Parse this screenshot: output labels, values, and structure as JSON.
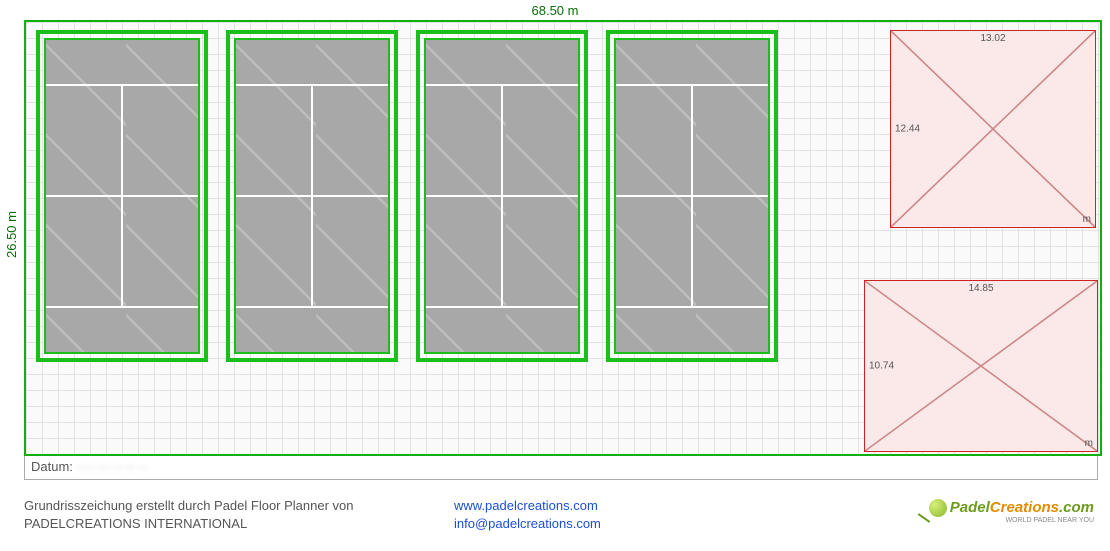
{
  "dims": {
    "width_label": "68.50 m",
    "height_label": "26.50 m"
  },
  "pinkA": {
    "w": "13.02",
    "h": "12.44",
    "unit": "m"
  },
  "pinkB": {
    "w": "14.85",
    "h": "10.74",
    "unit": "m"
  },
  "datum": {
    "label": "Datum:",
    "value": "···· ··· ·· ·· ··"
  },
  "footer": {
    "line1": "Grundrisszeichung erstellt durch Padel Floor Planner von",
    "line2": "PADELCREATIONS INTERNATIONAL",
    "url": "www.padelcreations.com",
    "email": "info@padelcreations.com"
  },
  "logo": {
    "p": "Padel",
    "c": "Creations",
    "tld": ".com",
    "tag": "WORLD PADEL NEAR YOU"
  }
}
